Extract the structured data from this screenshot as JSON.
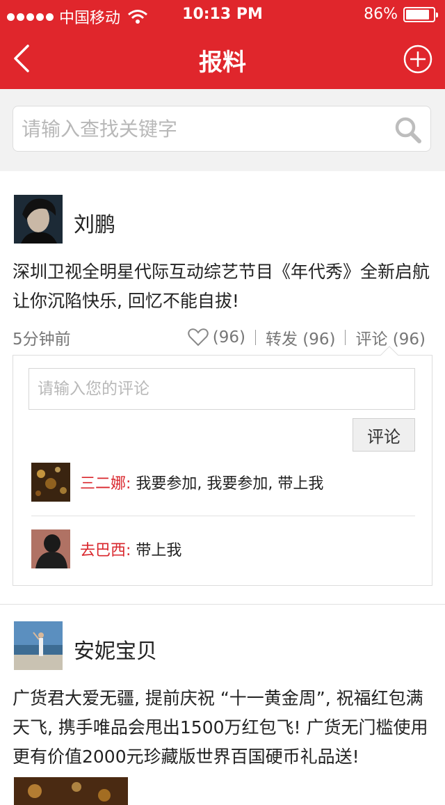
{
  "status_bar": {
    "carrier": "中国移动",
    "time": "10:13 PM",
    "battery": "86%",
    "battery_level": 0.86
  },
  "nav": {
    "title": "报料"
  },
  "search": {
    "placeholder": "请输入查找关键字"
  },
  "posts": [
    {
      "author": "刘鹏",
      "content": "深圳卫视全明星代际互动综艺节目《年代秀》全新启航让你沉陷快乐, 回忆不能自拔!",
      "time": "5分钟前",
      "likes": "(96)",
      "forward": "转发 (96)",
      "comment": "评论 (96)",
      "comment_placeholder": "请输入您的评论",
      "comment_button": "评论",
      "comments": [
        {
          "user": "三二娜:",
          "text": " 我要参加, 我要参加, 带上我"
        },
        {
          "user": "去巴西:",
          "text": " 带上我"
        }
      ]
    },
    {
      "author": "安妮宝贝",
      "content": "广货君大爱无疆, 提前庆祝 “十一黄金周”, 祝福红包满天飞, 携手唯品会甩出1500万红包飞! 广货无门槛使用更有价值2000元珍藏版世界百国硬币礼品送!"
    }
  ],
  "colors": {
    "brand": "#e0262c",
    "comment_user": "#d9262c"
  }
}
